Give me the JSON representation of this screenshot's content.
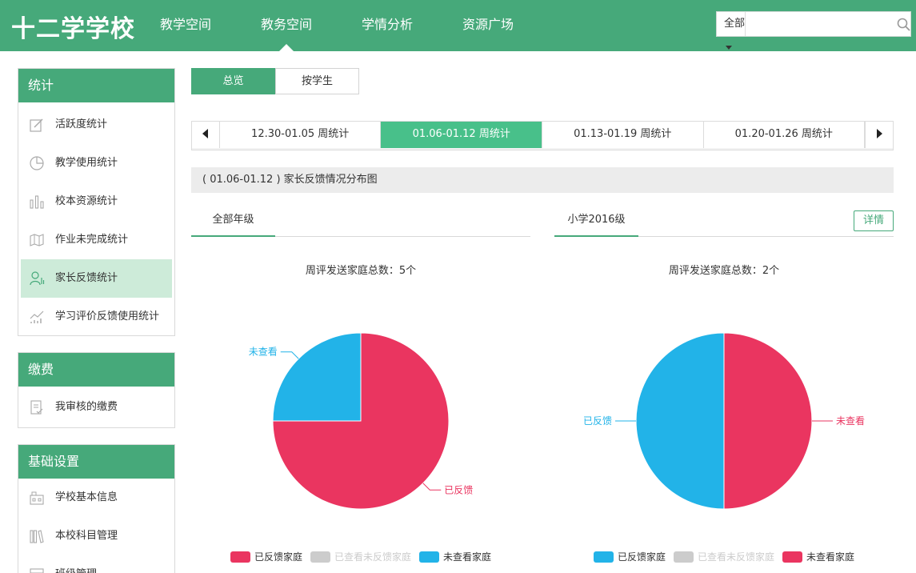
{
  "header": {
    "logo": "十二学学校",
    "nav": [
      {
        "label": "教学空间",
        "active": false
      },
      {
        "label": "教务空间",
        "active": true
      },
      {
        "label": "学情分析",
        "active": false
      },
      {
        "label": "资源广场",
        "active": false
      }
    ],
    "search": {
      "scope": "全部",
      "value": "",
      "placeholder": ""
    }
  },
  "sidebar": {
    "groups": [
      {
        "title": "统计",
        "items": [
          {
            "label": "活跃度统计",
            "icon": "edit-icon"
          },
          {
            "label": "教学使用统计",
            "icon": "pie-chart-icon"
          },
          {
            "label": "校本资源统计",
            "icon": "bar-chart-icon"
          },
          {
            "label": "作业未完成统计",
            "icon": "map-icon"
          },
          {
            "label": "家长反馈统计",
            "icon": "parent-icon",
            "active": true
          },
          {
            "label": "学习评价反馈使用统计",
            "icon": "trend-icon"
          }
        ]
      },
      {
        "title": "缴费",
        "items": [
          {
            "label": "我审核的缴费",
            "icon": "document-icon"
          }
        ]
      },
      {
        "title": "基础设置",
        "items": [
          {
            "label": "学校基本信息",
            "icon": "school-icon"
          },
          {
            "label": "本校科目管理",
            "icon": "books-icon"
          },
          {
            "label": "班级管理",
            "icon": "class-icon"
          }
        ]
      }
    ]
  },
  "view_tabs": [
    {
      "label": "总览",
      "active": true
    },
    {
      "label": "按学生",
      "active": false
    }
  ],
  "weeks": [
    {
      "label": "12.30-01.05 周统计",
      "active": false
    },
    {
      "label": "01.06-01.12 周统计",
      "active": true
    },
    {
      "label": "01.13-01.19 周统计",
      "active": false
    },
    {
      "label": "01.20-01.26 周统计",
      "active": false
    }
  ],
  "section_title": "( 01.06-01.12 ) 家长反馈情况分布图",
  "colors": {
    "accent": "#46a97a",
    "feedback": "#ea3560",
    "viewed_no_feedback": "#cccccc",
    "not_viewed": "#22b3e8"
  },
  "panels": [
    {
      "tab": "全部年级",
      "detail": "",
      "total": "周评发送家庭总数：5个"
    },
    {
      "tab": "小学2016级",
      "detail": "详情",
      "total": "周评发送家庭总数：2个"
    }
  ],
  "chart_data": [
    {
      "type": "pie",
      "title": "周评发送家庭总数：5个",
      "slices": [
        {
          "name": "已反馈家庭",
          "label": "已反馈",
          "value": 0.75,
          "color": "#ea3560"
        },
        {
          "name": "已查看未反馈家庭",
          "label": "",
          "value": 0,
          "color": "#cccccc"
        },
        {
          "name": "未查看家庭",
          "label": "未查看",
          "value": 0.25,
          "color": "#22b3e8"
        }
      ],
      "legend": [
        {
          "name": "已反馈家庭",
          "color": "#ea3560",
          "off": false
        },
        {
          "name": "已查看未反馈家庭",
          "color": "#cccccc",
          "off": true
        },
        {
          "name": "未查看家庭",
          "color": "#22b3e8",
          "off": false
        }
      ],
      "legend_position": "bottom"
    },
    {
      "type": "pie",
      "title": "周评发送家庭总数：2个",
      "slices": [
        {
          "name": "未查看家庭",
          "label": "未查看",
          "value": 0.5,
          "color": "#ea3560"
        },
        {
          "name": "已查看未反馈家庭",
          "label": "",
          "value": 0,
          "color": "#cccccc"
        },
        {
          "name": "已反馈家庭",
          "label": "已反馈",
          "value": 0.5,
          "color": "#22b3e8"
        }
      ],
      "legend": [
        {
          "name": "已反馈家庭",
          "color": "#22b3e8",
          "off": false
        },
        {
          "name": "已查看未反馈家庭",
          "color": "#cccccc",
          "off": true
        },
        {
          "name": "未查看家庭",
          "color": "#ea3560",
          "off": false
        }
      ],
      "legend_position": "bottom"
    }
  ]
}
